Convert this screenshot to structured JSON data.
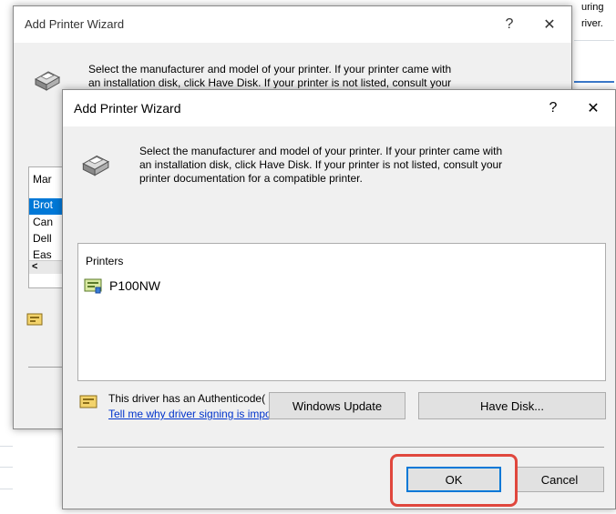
{
  "background": {
    "right_snippets": [
      "uring",
      "river."
    ]
  },
  "back_dialog": {
    "title": "Add Printer Wizard",
    "help_label": "?",
    "close_label": "✕",
    "instruction_line1": "Select the manufacturer and model of your printer. If your printer came with",
    "instruction_line2": "an installation disk, click Have Disk. If your printer is not listed, consult your",
    "manufacturer_header": "Mar",
    "manufacturers": [
      "Brot",
      "Can",
      "Dell",
      "Eas"
    ],
    "scroll_left": "<"
  },
  "front_dialog": {
    "title": "Add Printer Wizard",
    "help_label": "?",
    "close_label": "✕",
    "instruction_lines": [
      "Select the manufacturer and model of your printer. If your printer came with",
      "an installation disk, click Have Disk. If your printer is not listed, consult your",
      "printer documentation for a compatible printer."
    ],
    "printers_header": "Printers",
    "printers": [
      {
        "name": "P100NW"
      }
    ],
    "driver_note": "This driver has an Authenticode(tm) sigr",
    "driver_link": "Tell me why driver signing is important",
    "windows_update_label": "Windows Update",
    "have_disk_label": "Have Disk...",
    "ok_label": "OK",
    "cancel_label": "Cancel"
  },
  "colors": {
    "highlight": "#0078d7",
    "annotation_red": "#e0473d",
    "link": "#0033cc"
  }
}
